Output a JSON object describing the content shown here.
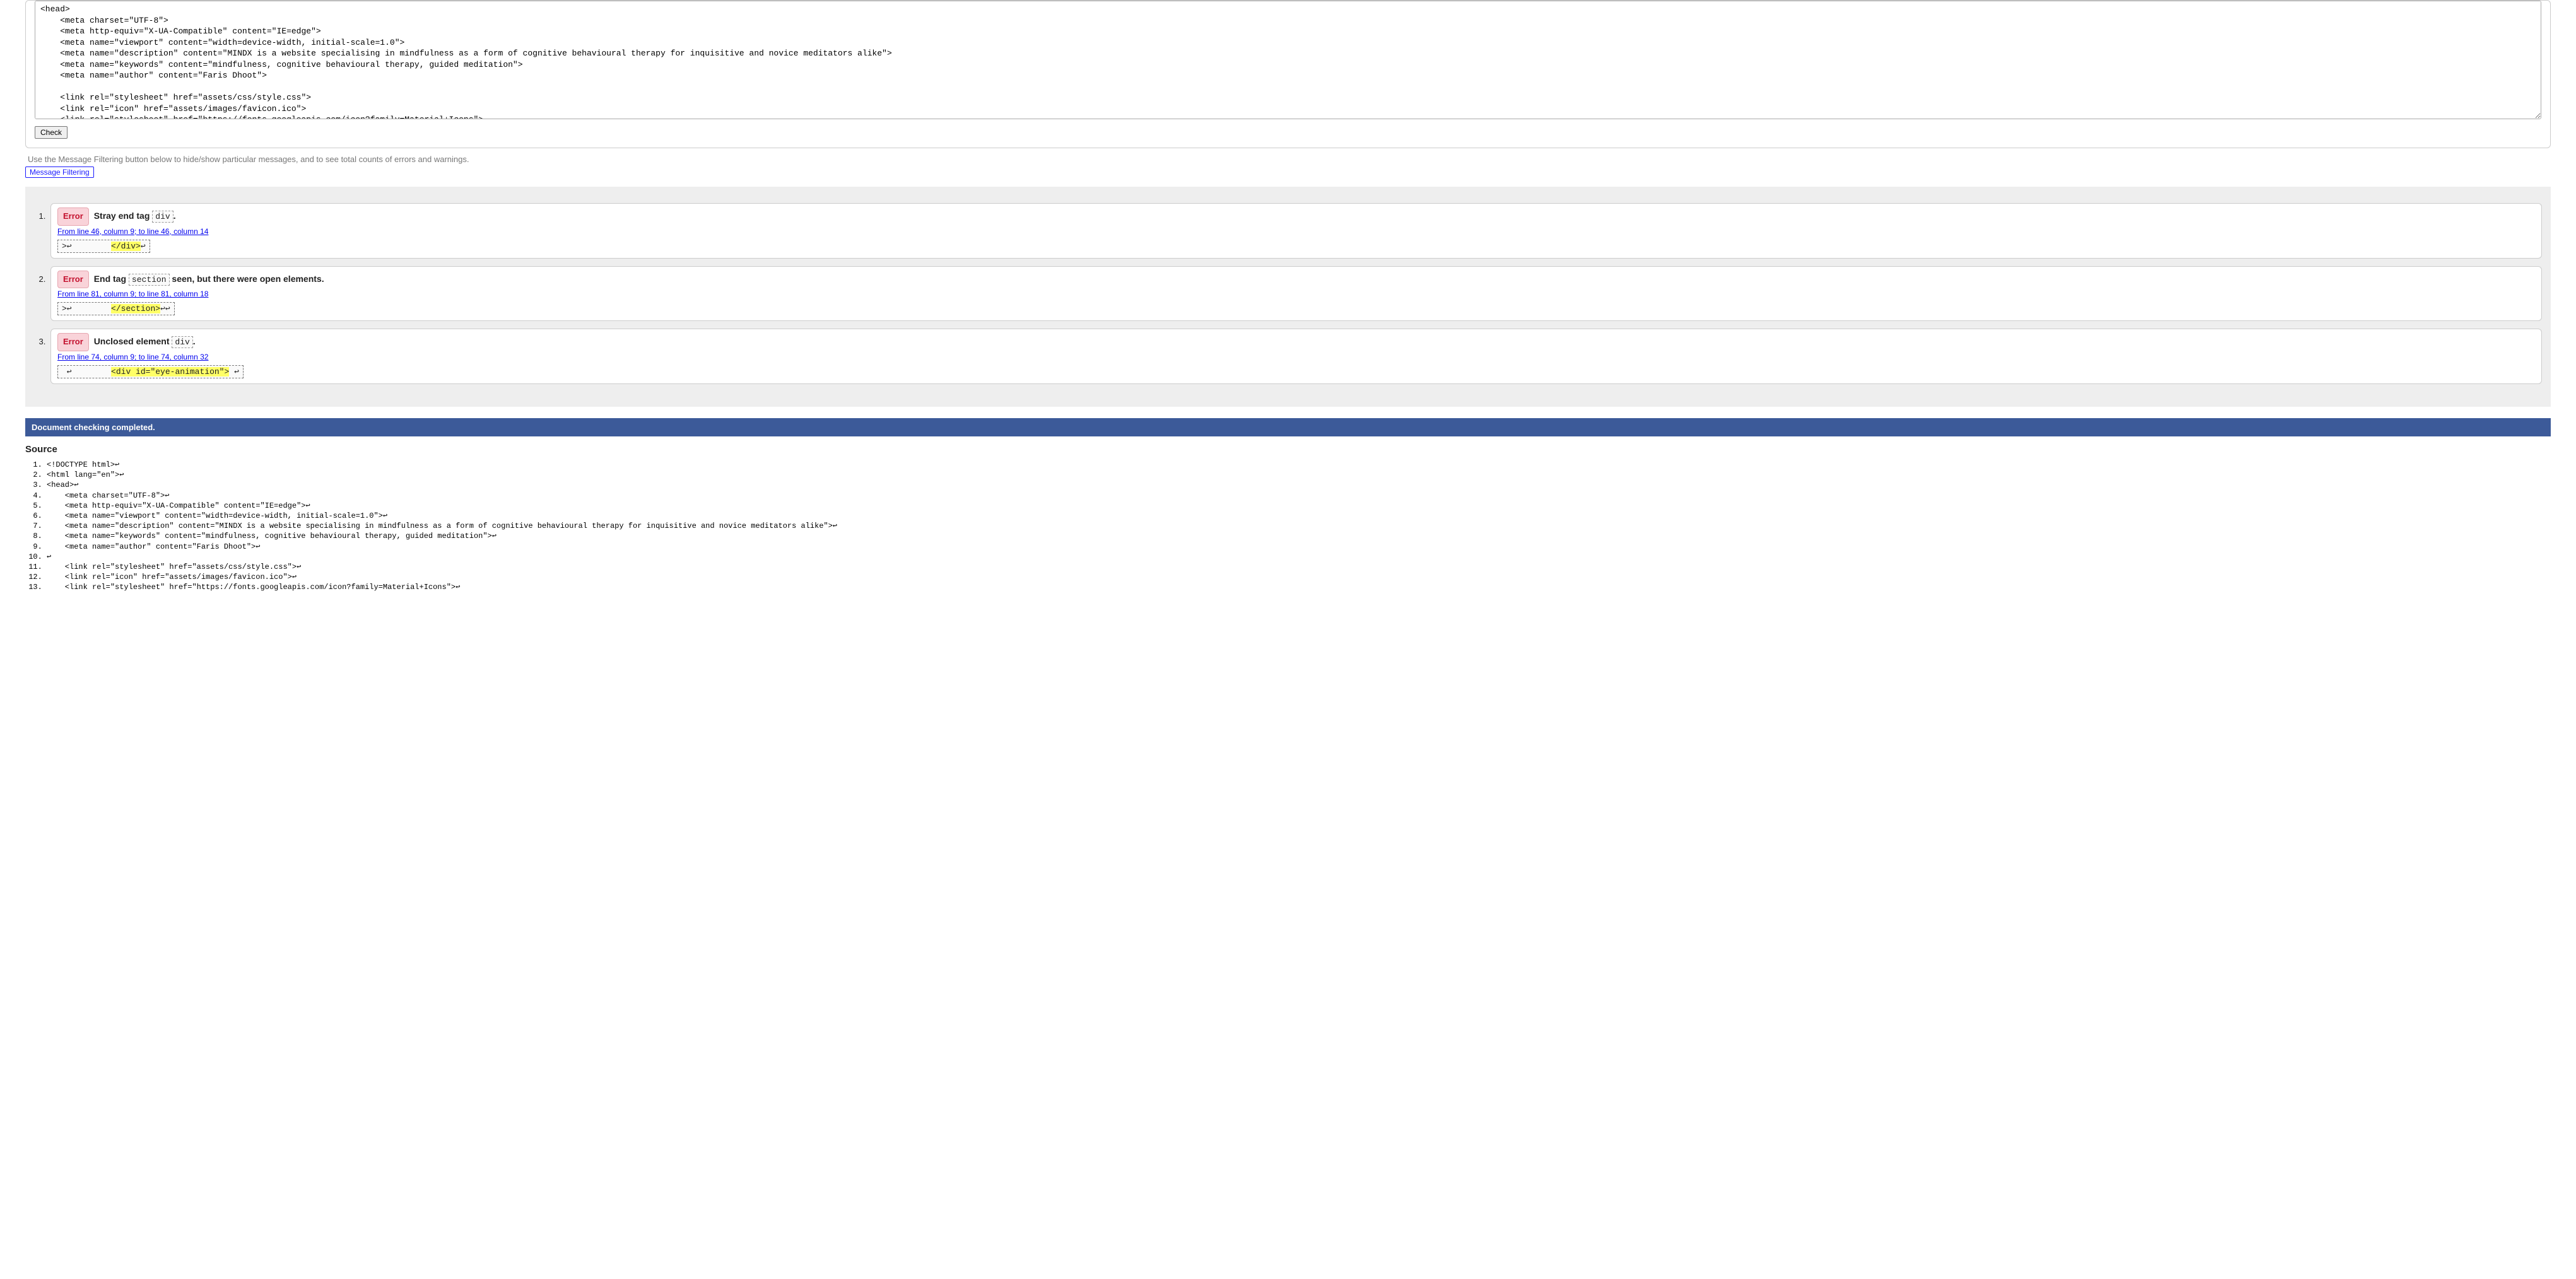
{
  "input_panel": {
    "textarea_value": "<head>\n    <meta charset=\"UTF-8\">\n    <meta http-equiv=\"X-UA-Compatible\" content=\"IE=edge\">\n    <meta name=\"viewport\" content=\"width=device-width, initial-scale=1.0\">\n    <meta name=\"description\" content=\"MINDX is a website specialising in mindfulness as a form of cognitive behavioural therapy for inquisitive and novice meditators alike\">\n    <meta name=\"keywords\" content=\"mindfulness, cognitive behavioural therapy, guided meditation\">\n    <meta name=\"author\" content=\"Faris Dhoot\">\n\n    <link rel=\"stylesheet\" href=\"assets/css/style.css\">\n    <link rel=\"icon\" href=\"assets/images/favicon.ico\">\n    <link rel=\"stylesheet\" href=\"https://fonts.googleapis.com/icon?family=Material+Icons\">\n\n    <title>MINDX</title>",
    "check_label": "Check"
  },
  "filter": {
    "hint": "Use the Message Filtering button below to hide/show particular messages, and to see total counts of errors and warnings.",
    "button_label": "Message Filtering"
  },
  "messages": [
    {
      "type": "Error",
      "intro": "Stray end tag ",
      "code": "div",
      "tail": ".",
      "location": "From line 46, column 9; to line 46, column 14",
      "extract_pre": ">↩        ",
      "extract_hl": "</div>",
      "extract_post": "↩"
    },
    {
      "type": "Error",
      "intro": "End tag ",
      "code": "section",
      "tail": " seen, but there were open elements.",
      "location": "From line 81, column 9; to line 81, column 18",
      "extract_pre": ">↩        ",
      "extract_hl": "</section>",
      "extract_post": "↩↩"
    },
    {
      "type": "Error",
      "intro": "Unclosed element ",
      "code": "div",
      "tail": ".",
      "location": "From line 74, column 9; to line 74, column 32",
      "extract_pre": " ↩        ",
      "extract_hl": "<div id=\"eye-animation\">",
      "extract_post": " ↩"
    }
  ],
  "completed_label": "Document checking completed.",
  "source_heading": "Source",
  "source_lines": [
    "<!DOCTYPE html>↩",
    "<html lang=\"en\">↩",
    "<head>↩",
    "    <meta charset=\"UTF-8\">↩",
    "    <meta http-equiv=\"X-UA-Compatible\" content=\"IE=edge\">↩",
    "    <meta name=\"viewport\" content=\"width=device-width, initial-scale=1.0\">↩",
    "    <meta name=\"description\" content=\"MINDX is a website specialising in mindfulness as a form of cognitive behavioural therapy for inquisitive and novice meditators alike\">↩",
    "    <meta name=\"keywords\" content=\"mindfulness, cognitive behavioural therapy, guided meditation\">↩",
    "    <meta name=\"author\" content=\"Faris Dhoot\">↩",
    "↩",
    "    <link rel=\"stylesheet\" href=\"assets/css/style.css\">↩",
    "    <link rel=\"icon\" href=\"assets/images/favicon.ico\">↩",
    "    <link rel=\"stylesheet\" href=\"https://fonts.googleapis.com/icon?family=Material+Icons\">↩"
  ]
}
